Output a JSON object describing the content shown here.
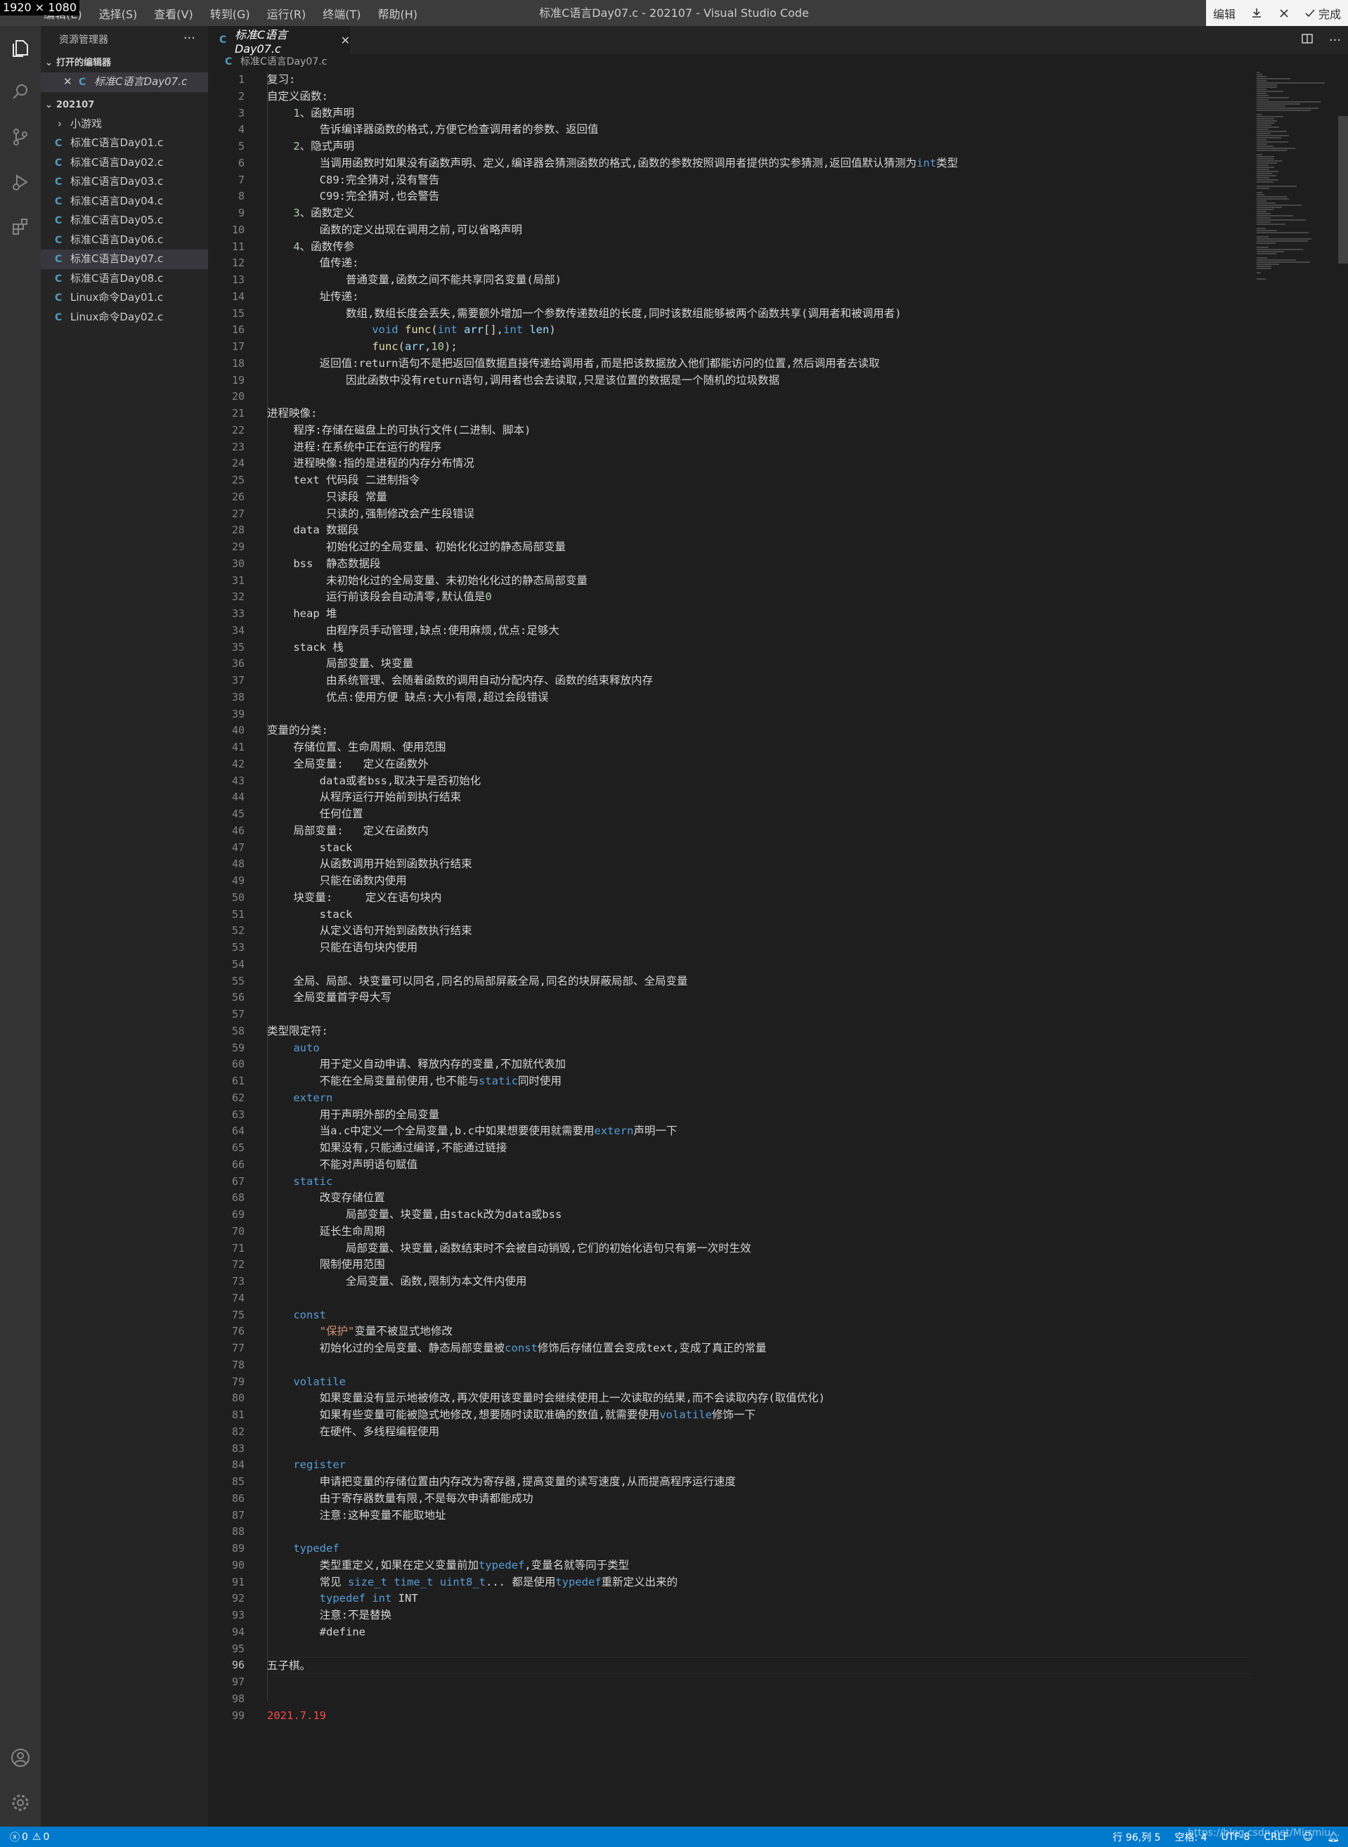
{
  "size_badge": "1920 × 1080",
  "menu": [
    "编辑(E)",
    "选择(S)",
    "查看(V)",
    "转到(G)",
    "运行(R)",
    "终端(T)",
    "帮助(H)"
  ],
  "window_title": "标准C语言Day07.c - 202107 - Visual Studio Code",
  "window_buttons": {
    "edit": "编辑",
    "done": "完成"
  },
  "sidebar": {
    "title": "资源管理器",
    "open_editors_label": "打开的编辑器",
    "open_file": "标准C语言Day07.c",
    "folder": "202107",
    "subfolder": "小游戏",
    "files": [
      "标准C语言Day01.c",
      "标准C语言Day02.c",
      "标准C语言Day03.c",
      "标准C语言Day04.c",
      "标准C语言Day05.c",
      "标准C语言Day06.c",
      "标准C语言Day07.c",
      "标准C语言Day08.c",
      "Linux命令Day01.c",
      "Linux命令Day02.c"
    ],
    "file_icon": "C"
  },
  "tab": {
    "name": "标准C语言Day07.c"
  },
  "breadcrumb": "标准C语言Day07.c",
  "code_lines": [
    "复习:",
    "自定义函数:",
    "    1、函数声明",
    "        告诉编译器函数的格式,方便它检查调用者的参数、返回值",
    "    2、隐式声明",
    "        当调用函数时如果没有函数声明、定义,编译器会猜测函数的格式,函数的参数按照调用者提供的实参猜测,返回值默认猜测为int类型",
    "        C89:完全猜对,没有警告",
    "        C99:完全猜对,也会警告",
    "    3、函数定义",
    "        函数的定义出现在调用之前,可以省略声明",
    "    4、函数传参",
    "        值传递:",
    "            普通变量,函数之间不能共享同名变量(局部)",
    "        址传递:",
    "            数组,数组长度会丢失,需要额外增加一个参数传递数组的长度,同时该数组能够被两个函数共享(调用者和被调用者)",
    "                void func(int arr[],int len)",
    "                func(arr,10);",
    "        返回值:return语句不是把返回值数据直接传递给调用者,而是把该数据放入他们都能访问的位置,然后调用者去读取",
    "            因此函数中没有return语句,调用者也会去读取,只是该位置的数据是一个随机的垃圾数据",
    "",
    "进程映像:",
    "    程序:存储在磁盘上的可执行文件(二进制、脚本)",
    "    进程:在系统中正在运行的程序",
    "    进程映像:指的是进程的内存分布情况",
    "    text 代码段 二进制指令",
    "         只读段 常量",
    "         只读的,强制修改会产生段错误",
    "    data 数据段",
    "         初始化过的全局变量、初始化化过的静态局部变量",
    "    bss  静态数据段",
    "         未初始化过的全局变量、未初始化化过的静态局部变量",
    "         运行前该段会自动清零,默认值是0",
    "    heap 堆",
    "         由程序员手动管理,缺点:使用麻烦,优点:足够大",
    "    stack 栈",
    "         局部变量、块变量",
    "         由系统管理、会随着函数的调用自动分配内存、函数的结束释放内存",
    "         优点:使用方便 缺点:大小有限,超过会段错误",
    "",
    "变量的分类:",
    "    存储位置、生命周期、使用范围",
    "    全局变量:   定义在函数外",
    "        data或者bss,取决于是否初始化",
    "        从程序运行开始前到执行结束",
    "        任何位置",
    "    局部变量:   定义在函数内",
    "        stack",
    "        从函数调用开始到函数执行结束",
    "        只能在函数内使用",
    "    块变量:     定义在语句块内",
    "        stack",
    "        从定义语句开始到函数执行结束",
    "        只能在语句块内使用",
    "",
    "    全局、局部、块变量可以同名,同名的局部屏蔽全局,同名的块屏蔽局部、全局变量",
    "    全局变量首字母大写",
    "",
    "类型限定符:",
    "    auto",
    "        用于定义自动申请、释放内存的变量,不加就代表加",
    "        不能在全局变量前使用,也不能与static同时使用",
    "    extern",
    "        用于声明外部的全局变量",
    "        当a.c中定义一个全局变量,b.c中如果想要使用就需要用extern声明一下",
    "        如果没有,只能通过编译,不能通过链接",
    "        不能对声明语句赋值",
    "    static",
    "        改变存储位置",
    "            局部变量、块变量,由stack改为data或bss",
    "        延长生命周期",
    "            局部变量、块变量,函数结束时不会被自动销毁,它们的初始化语句只有第一次时生效",
    "        限制使用范围",
    "            全局变量、函数,限制为本文件内使用",
    "",
    "    const",
    "        \"保护\"变量不被显式地修改",
    "        初始化过的全局变量、静态局部变量被const修饰后存储位置会变成text,变成了真正的常量",
    "",
    "    volatile",
    "        如果变量没有显示地被修改,再次使用该变量时会继续使用上一次读取的结果,而不会读取内存(取值优化)",
    "        如果有些变量可能被隐式地修改,想要随时读取准确的数值,就需要使用volatile修饰一下",
    "        在硬件、多线程编程使用",
    "",
    "    register",
    "        申请把变量的存储位置由内存改为寄存器,提高变量的读写速度,从而提高程序运行速度",
    "        由于寄存器数量有限,不是每次申请都能成功",
    "        注意:这种变量不能取地址",
    "",
    "    typedef",
    "        类型重定义,如果在定义变量前加typedef,变量名就等同于类型",
    "        常见 size_t time_t uint8_t... 都是使用typedef重新定义出来的",
    "        typedef int INT",
    "        注意:不是替换",
    "        #define",
    "",
    "五子棋。",
    "",
    "",
    "2021.7.19"
  ],
  "current_line": 96,
  "status": {
    "errors": "0",
    "warnings": "0",
    "position": "行 96,列 5",
    "spaces": "空格: 4",
    "encoding": "UTF-8",
    "eol": "CRLF",
    "watermark": "https://blog.csdn.net/Mirrmiu..."
  },
  "colors": {
    "keyword": "#569cd6",
    "function": "#dcdcaa",
    "string": "#ce9178",
    "date": "#f14c4c",
    "statusbar": "#007acc"
  }
}
